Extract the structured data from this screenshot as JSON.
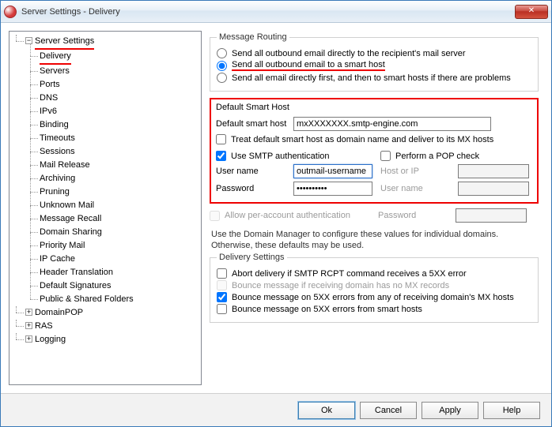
{
  "window": {
    "title": "Server Settings - Delivery"
  },
  "tree": {
    "root": "Server Settings",
    "items": [
      "Delivery",
      "Servers",
      "Ports",
      "DNS",
      "IPv6",
      "Binding",
      "Timeouts",
      "Sessions",
      "Mail Release",
      "Archiving",
      "Pruning",
      "Unknown Mail",
      "Message Recall",
      "Domain Sharing",
      "Priority Mail",
      "IP Cache",
      "Header Translation",
      "Default Signatures",
      "Public & Shared Folders"
    ],
    "siblings": [
      "DomainPOP",
      "RAS",
      "Logging"
    ]
  },
  "routing": {
    "legend": "Message Routing",
    "opt1": "Send all outbound email directly to the recipient's mail server",
    "opt2": "Send all outbound email to a smart host",
    "opt3": "Send all email directly first, and then to smart hosts if there are problems"
  },
  "smarthost": {
    "legend": "Default Smart Host",
    "host_label": "Default smart host",
    "host_value": "mxXXXXXXX.smtp-engine.com",
    "treat_label": "Treat default smart host as domain name and deliver to its MX hosts",
    "use_smtp": "Use SMTP authentication",
    "pop_check": "Perform a POP check",
    "user_label": "User name",
    "user_value": "outmail-username",
    "hostip_label": "Host or IP",
    "pass_label": "Password",
    "pass_value": "••••••••••",
    "user2_label": "User name",
    "allow_per": "Allow per-account authentication",
    "password2_label": "Password",
    "note": "Use the Domain Manager to configure these values for individual domains. Otherwise, these defaults may be used."
  },
  "delivery": {
    "legend": "Delivery Settings",
    "d1": "Abort delivery if SMTP RCPT command receives a  5XX error",
    "d2": "Bounce message if receiving domain has no MX records",
    "d3": "Bounce message on 5XX errors from any of receiving domain's MX hosts",
    "d4": "Bounce message on 5XX errors from smart hosts"
  },
  "buttons": {
    "ok": "Ok",
    "cancel": "Cancel",
    "apply": "Apply",
    "help": "Help"
  }
}
